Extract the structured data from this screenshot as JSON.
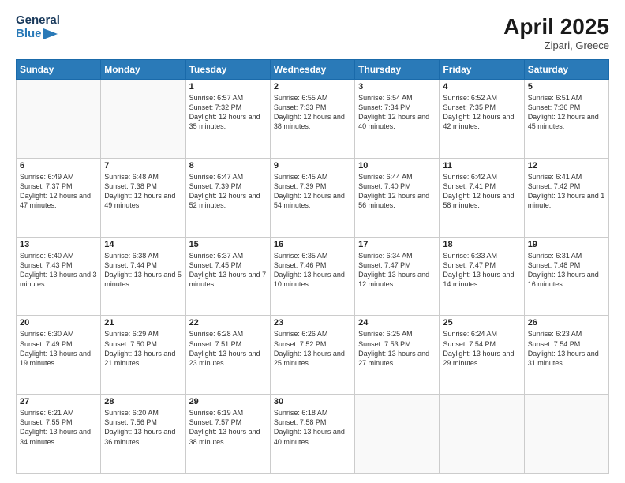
{
  "header": {
    "logo_line1": "General",
    "logo_line2": "Blue",
    "month_title": "April 2025",
    "location": "Zipari, Greece"
  },
  "days_of_week": [
    "Sunday",
    "Monday",
    "Tuesday",
    "Wednesday",
    "Thursday",
    "Friday",
    "Saturday"
  ],
  "weeks": [
    [
      {
        "day": "",
        "info": ""
      },
      {
        "day": "",
        "info": ""
      },
      {
        "day": "1",
        "info": "Sunrise: 6:57 AM\nSunset: 7:32 PM\nDaylight: 12 hours and 35 minutes."
      },
      {
        "day": "2",
        "info": "Sunrise: 6:55 AM\nSunset: 7:33 PM\nDaylight: 12 hours and 38 minutes."
      },
      {
        "day": "3",
        "info": "Sunrise: 6:54 AM\nSunset: 7:34 PM\nDaylight: 12 hours and 40 minutes."
      },
      {
        "day": "4",
        "info": "Sunrise: 6:52 AM\nSunset: 7:35 PM\nDaylight: 12 hours and 42 minutes."
      },
      {
        "day": "5",
        "info": "Sunrise: 6:51 AM\nSunset: 7:36 PM\nDaylight: 12 hours and 45 minutes."
      }
    ],
    [
      {
        "day": "6",
        "info": "Sunrise: 6:49 AM\nSunset: 7:37 PM\nDaylight: 12 hours and 47 minutes."
      },
      {
        "day": "7",
        "info": "Sunrise: 6:48 AM\nSunset: 7:38 PM\nDaylight: 12 hours and 49 minutes."
      },
      {
        "day": "8",
        "info": "Sunrise: 6:47 AM\nSunset: 7:39 PM\nDaylight: 12 hours and 52 minutes."
      },
      {
        "day": "9",
        "info": "Sunrise: 6:45 AM\nSunset: 7:39 PM\nDaylight: 12 hours and 54 minutes."
      },
      {
        "day": "10",
        "info": "Sunrise: 6:44 AM\nSunset: 7:40 PM\nDaylight: 12 hours and 56 minutes."
      },
      {
        "day": "11",
        "info": "Sunrise: 6:42 AM\nSunset: 7:41 PM\nDaylight: 12 hours and 58 minutes."
      },
      {
        "day": "12",
        "info": "Sunrise: 6:41 AM\nSunset: 7:42 PM\nDaylight: 13 hours and 1 minute."
      }
    ],
    [
      {
        "day": "13",
        "info": "Sunrise: 6:40 AM\nSunset: 7:43 PM\nDaylight: 13 hours and 3 minutes."
      },
      {
        "day": "14",
        "info": "Sunrise: 6:38 AM\nSunset: 7:44 PM\nDaylight: 13 hours and 5 minutes."
      },
      {
        "day": "15",
        "info": "Sunrise: 6:37 AM\nSunset: 7:45 PM\nDaylight: 13 hours and 7 minutes."
      },
      {
        "day": "16",
        "info": "Sunrise: 6:35 AM\nSunset: 7:46 PM\nDaylight: 13 hours and 10 minutes."
      },
      {
        "day": "17",
        "info": "Sunrise: 6:34 AM\nSunset: 7:47 PM\nDaylight: 13 hours and 12 minutes."
      },
      {
        "day": "18",
        "info": "Sunrise: 6:33 AM\nSunset: 7:47 PM\nDaylight: 13 hours and 14 minutes."
      },
      {
        "day": "19",
        "info": "Sunrise: 6:31 AM\nSunset: 7:48 PM\nDaylight: 13 hours and 16 minutes."
      }
    ],
    [
      {
        "day": "20",
        "info": "Sunrise: 6:30 AM\nSunset: 7:49 PM\nDaylight: 13 hours and 19 minutes."
      },
      {
        "day": "21",
        "info": "Sunrise: 6:29 AM\nSunset: 7:50 PM\nDaylight: 13 hours and 21 minutes."
      },
      {
        "day": "22",
        "info": "Sunrise: 6:28 AM\nSunset: 7:51 PM\nDaylight: 13 hours and 23 minutes."
      },
      {
        "day": "23",
        "info": "Sunrise: 6:26 AM\nSunset: 7:52 PM\nDaylight: 13 hours and 25 minutes."
      },
      {
        "day": "24",
        "info": "Sunrise: 6:25 AM\nSunset: 7:53 PM\nDaylight: 13 hours and 27 minutes."
      },
      {
        "day": "25",
        "info": "Sunrise: 6:24 AM\nSunset: 7:54 PM\nDaylight: 13 hours and 29 minutes."
      },
      {
        "day": "26",
        "info": "Sunrise: 6:23 AM\nSunset: 7:54 PM\nDaylight: 13 hours and 31 minutes."
      }
    ],
    [
      {
        "day": "27",
        "info": "Sunrise: 6:21 AM\nSunset: 7:55 PM\nDaylight: 13 hours and 34 minutes."
      },
      {
        "day": "28",
        "info": "Sunrise: 6:20 AM\nSunset: 7:56 PM\nDaylight: 13 hours and 36 minutes."
      },
      {
        "day": "29",
        "info": "Sunrise: 6:19 AM\nSunset: 7:57 PM\nDaylight: 13 hours and 38 minutes."
      },
      {
        "day": "30",
        "info": "Sunrise: 6:18 AM\nSunset: 7:58 PM\nDaylight: 13 hours and 40 minutes."
      },
      {
        "day": "",
        "info": ""
      },
      {
        "day": "",
        "info": ""
      },
      {
        "day": "",
        "info": ""
      }
    ]
  ]
}
